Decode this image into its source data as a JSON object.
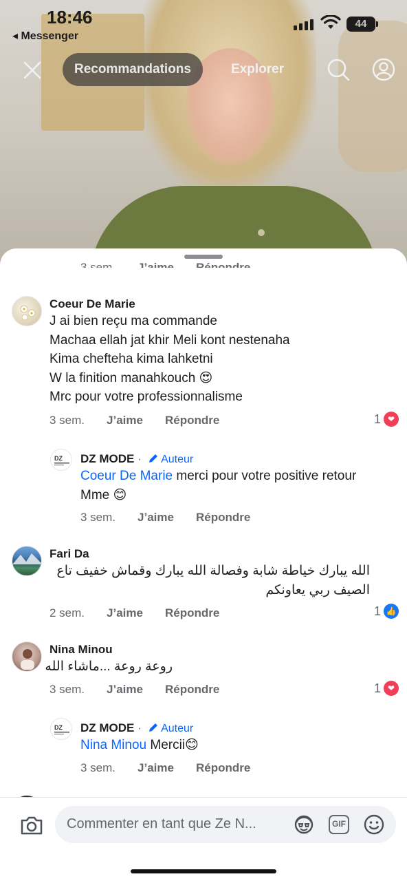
{
  "status_bar": {
    "time": "18:46",
    "back_app": "◂ Messenger",
    "battery": "44"
  },
  "nav": {
    "tab_active": "Recommandations",
    "tab_other": "Explorer"
  },
  "sheet": {
    "cut_row": {
      "time": "3 sem.",
      "like": "J’aime",
      "reply": "Répondre"
    },
    "comments": [
      {
        "author": "Coeur De Marie",
        "lines": [
          "J ai bien reçu ma commande",
          "Machaa ellah jat khir Meli kont nestenaha",
          "Kima chefteha kima lahketni",
          "W la finition manahkouch 😍",
          "Mrc pour votre professionnalisme"
        ],
        "time": "3 sem.",
        "like": "J’aime",
        "reply": "Répondre",
        "reaction_count": "1",
        "reaction": "love"
      },
      {
        "author": "DZ MODE",
        "badge": "Auteur",
        "dot": "·",
        "mention": "Coeur De Marie",
        "text_line1": " merci pour votre positive retour",
        "text_line2": "Mme 😊",
        "time": "3 sem.",
        "like": "J’aime",
        "reply": "Répondre"
      },
      {
        "author": "Fari Da",
        "lines": [
          "الله يبارك  خياطة شابة وفصالة الله يبارك وقماش خفيف تاع",
          "الصيف ربي يعاونكم"
        ],
        "time": "2 sem.",
        "like": "J’aime",
        "reply": "Répondre",
        "reaction_count": "1",
        "reaction": "like"
      },
      {
        "author": "Nina Minou",
        "lines": [
          "روعة روعة ...ماشاء الله"
        ],
        "time": "3 sem.",
        "like": "J’aime",
        "reply": "Répondre",
        "reaction_count": "1",
        "reaction": "love"
      },
      {
        "author": "DZ MODE",
        "badge": "Auteur",
        "dot": "·",
        "mention": "Nina Minou",
        "text_line1": " Mercii😊",
        "time": "3 sem.",
        "like": "J’aime",
        "reply": "Répondre"
      }
    ]
  },
  "composer": {
    "placeholder": "Commenter en tant que Ze N...",
    "gif": "GIF"
  },
  "colors": {
    "accent": "#0866ff",
    "love": "#f33e58",
    "like": "#1877f2"
  }
}
